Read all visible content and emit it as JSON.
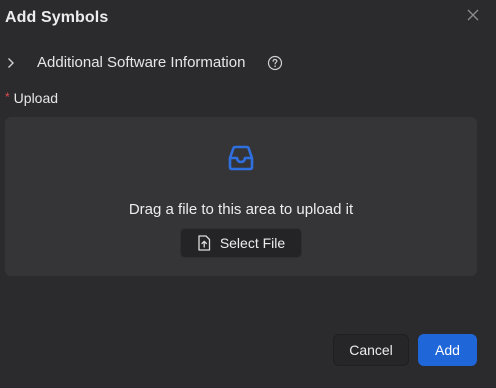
{
  "dialog": {
    "title": "Add Symbols",
    "close_icon": "close-icon"
  },
  "section": {
    "expand_icon": "chevron-right-icon",
    "label": "Additional Software Information",
    "help_icon": "help-circle-icon"
  },
  "upload": {
    "required_mark": "*",
    "label": "Upload",
    "dropzone_icon": "inbox-icon",
    "hint": "Drag a file to this area to upload it",
    "select_icon": "file-upload-icon",
    "select_label": "Select File"
  },
  "footer": {
    "cancel_label": "Cancel",
    "add_label": "Add"
  },
  "colors": {
    "background": "#2b2b2d",
    "dropzone": "#353538",
    "accent": "#1f66d9",
    "required": "#e5484d"
  }
}
